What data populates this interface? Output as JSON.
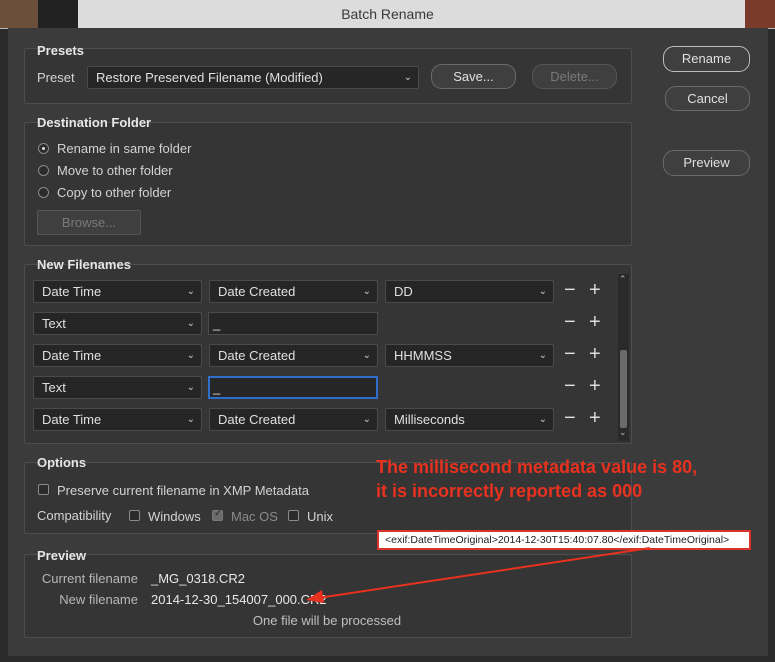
{
  "window": {
    "title": "Batch Rename"
  },
  "presets": {
    "section": "Presets",
    "label": "Preset",
    "value": "Restore Preserved Filename (Modified)",
    "save": "Save...",
    "delete": "Delete..."
  },
  "actions": {
    "rename": "Rename",
    "cancel": "Cancel",
    "preview": "Preview"
  },
  "destination": {
    "section": "Destination Folder",
    "options": [
      {
        "label": "Rename in same folder",
        "selected": true
      },
      {
        "label": "Move to other folder",
        "selected": false
      },
      {
        "label": "Copy to other folder",
        "selected": false
      }
    ],
    "browse": "Browse..."
  },
  "new_filenames": {
    "section": "New Filenames",
    "rows": [
      {
        "type": "Date Time",
        "field2": "Date Created",
        "field3": "DD"
      },
      {
        "type": "Text",
        "text": "_"
      },
      {
        "type": "Date Time",
        "field2": "Date Created",
        "field3": "HHMMSS"
      },
      {
        "type": "Text",
        "text": "_"
      },
      {
        "type": "Date Time",
        "field2": "Date Created",
        "field3": "Milliseconds"
      }
    ]
  },
  "options": {
    "section": "Options",
    "preserve": "Preserve current filename in XMP Metadata",
    "compat_label": "Compatibility",
    "compat": [
      {
        "label": "Windows",
        "checked": false
      },
      {
        "label": "Mac OS",
        "checked": true,
        "disabled": true
      },
      {
        "label": "Unix",
        "checked": false
      }
    ]
  },
  "preview": {
    "section": "Preview",
    "current_label": "Current filename",
    "current_value": "_MG_0318.CR2",
    "new_label": "New filename",
    "new_value": "2014-12-30_154007_000.CR2",
    "count": "One file will be processed"
  },
  "annotation": {
    "line1": "The millisecond metadata value is 80,",
    "line2": "it is incorrectly reported as 000",
    "xml": "<exif:DateTimeOriginal>2014-12-30T15:40:07.80</exif:DateTimeOriginal>",
    "color": "#e8321f"
  }
}
